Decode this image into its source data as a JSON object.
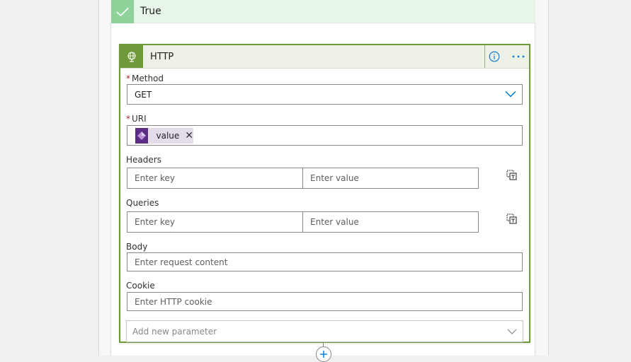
{
  "branch": {
    "label": "True"
  },
  "action": {
    "title": "HTTP",
    "method": {
      "label": "Method",
      "required_mark": "*",
      "value": "GET"
    },
    "uri": {
      "label": "URI",
      "required_mark": "*",
      "token_label": "value"
    },
    "headers": {
      "label": "Headers",
      "key_placeholder": "Enter key",
      "value_placeholder": "Enter value"
    },
    "queries": {
      "label": "Queries",
      "key_placeholder": "Enter key",
      "value_placeholder": "Enter value"
    },
    "body": {
      "label": "Body",
      "placeholder": "Enter request content"
    },
    "cookie": {
      "label": "Cookie",
      "placeholder": "Enter HTTP cookie"
    },
    "add_parameter": {
      "placeholder": "Add new parameter"
    }
  },
  "colors": {
    "action_accent": "#6f9a3a",
    "true_branch": "#8fd39a",
    "token_icon": "#5b2d84",
    "required": "#a4262c",
    "link_blue": "#0078d4"
  },
  "icons": {
    "branch": "checkmark-icon",
    "action": "globe-icon",
    "info": "info-icon",
    "more": "more-options-icon",
    "method_dropdown": "chevron-down-icon",
    "token": "expression-icon",
    "token_remove": "close-icon",
    "headers_mode": "switch-to-text-mode-icon",
    "queries_mode": "switch-to-text-mode-icon",
    "add_parameter": "chevron-down-icon",
    "add_step": "plus-icon"
  }
}
